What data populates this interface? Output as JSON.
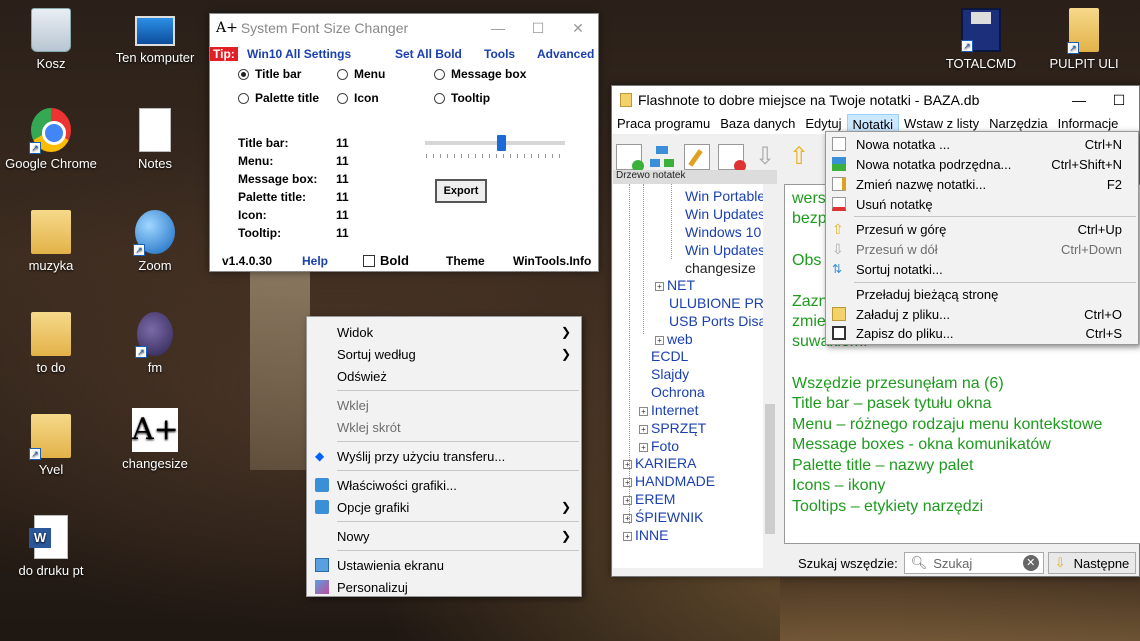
{
  "desktop": {
    "icons": [
      {
        "label": "Kosz"
      },
      {
        "label": "Ten komputer"
      },
      {
        "label": "Google Chrome"
      },
      {
        "label": "Notes"
      },
      {
        "label": "muzyka"
      },
      {
        "label": "Zoom"
      },
      {
        "label": "to do"
      },
      {
        "label": "fm"
      },
      {
        "label": "Yvel"
      },
      {
        "label": "changesize"
      },
      {
        "label": "do druku pt"
      },
      {
        "label": "TOTALCMD"
      },
      {
        "label": "PULPIT ULI"
      }
    ]
  },
  "fontsizer": {
    "title": "System Font Size Changer",
    "logo": "A+",
    "tip": "Tip:",
    "menu": [
      "Win10 All Settings",
      "Set All Bold",
      "Tools",
      "Advanced"
    ],
    "radios": [
      "Title bar",
      "Menu",
      "Message box",
      "Palette title",
      "Icon",
      "Tooltip"
    ],
    "values": [
      {
        "label": "Title bar:",
        "value": "11"
      },
      {
        "label": "Menu:",
        "value": "11"
      },
      {
        "label": "Message box:",
        "value": "11"
      },
      {
        "label": "Palette title:",
        "value": "11"
      },
      {
        "label": "Icon:",
        "value": "11"
      },
      {
        "label": "Tooltip:",
        "value": "11"
      }
    ],
    "export": "Export",
    "version": "v1.4.0.30",
    "help": "Help",
    "bold": "Bold",
    "theme": "Theme",
    "site": "WinTools.Info"
  },
  "context_menu": {
    "items": [
      {
        "label": "Widok"
      },
      {
        "label": "Sortuj według"
      },
      {
        "label": "Odśwież"
      },
      {
        "label": "Wklej"
      },
      {
        "label": "Wklej skrót"
      },
      {
        "label": "Wyślij przy użyciu transferu..."
      },
      {
        "label": "Właściwości grafiki..."
      },
      {
        "label": "Opcje grafiki"
      },
      {
        "label": "Nowy"
      },
      {
        "label": "Ustawienia ekranu"
      },
      {
        "label": "Personalizuj"
      }
    ]
  },
  "flashnote": {
    "title": "Flashnote to dobre miejsce na Twoje notatki - BAZA.db",
    "menu": [
      "Praca programu",
      "Baza danych",
      "Edytuj",
      "Notatki",
      "Wstaw z listy",
      "Narzędzia",
      "Informacje"
    ],
    "tree_header": "Drzewo notatek",
    "tree": [
      "Win Portable",
      "Win Updates",
      "Windows 10",
      "Win Updates",
      "changesize",
      "NET",
      "ULUBIONE PR",
      "USB Ports Disa",
      "web",
      "ECDL",
      "Slajdy",
      "Ochrona",
      "Internet",
      "SPRZĘT",
      "Foto",
      "KARIERA",
      "HANDMADE",
      "EREM",
      "ŚPIEWNIK",
      "INNE"
    ],
    "editor_lines": [
      "wers",
      "bezp",
      "Obs",
      "Zazn",
      "zmie",
      "suwakiem.",
      "Wszędzie przesunęłam na (6)",
      "Title bar – pasek tytułu okna",
      "Menu – różnego rodzaju menu kontekstowe",
      "Message boxes - okna komunikatów",
      "Palette title – nazwy palet",
      "Icons – ikony",
      "Tooltips – etykiety narzędzi"
    ],
    "search_label": "Szukaj wszędzie:",
    "search_placeholder": "Szukaj",
    "next": "Następne"
  },
  "notatki_menu": {
    "items": [
      {
        "label": "Nowa notatka ...",
        "shortcut": "Ctrl+N"
      },
      {
        "label": "Nowa notatka podrzędna...",
        "shortcut": "Ctrl+Shift+N"
      },
      {
        "label": "Zmień nazwę notatki...",
        "shortcut": "F2"
      },
      {
        "label": "Usuń notatkę",
        "shortcut": ""
      },
      {
        "label": "Przesuń w górę",
        "shortcut": "Ctrl+Up"
      },
      {
        "label": "Przesuń w dół",
        "shortcut": "Ctrl+Down"
      },
      {
        "label": "Sortuj notatki...",
        "shortcut": ""
      },
      {
        "label": "Przeładuj bieżącą stronę",
        "shortcut": ""
      },
      {
        "label": "Załaduj z pliku...",
        "shortcut": "Ctrl+O"
      },
      {
        "label": "Zapisz do pliku...",
        "shortcut": "Ctrl+S"
      }
    ]
  }
}
